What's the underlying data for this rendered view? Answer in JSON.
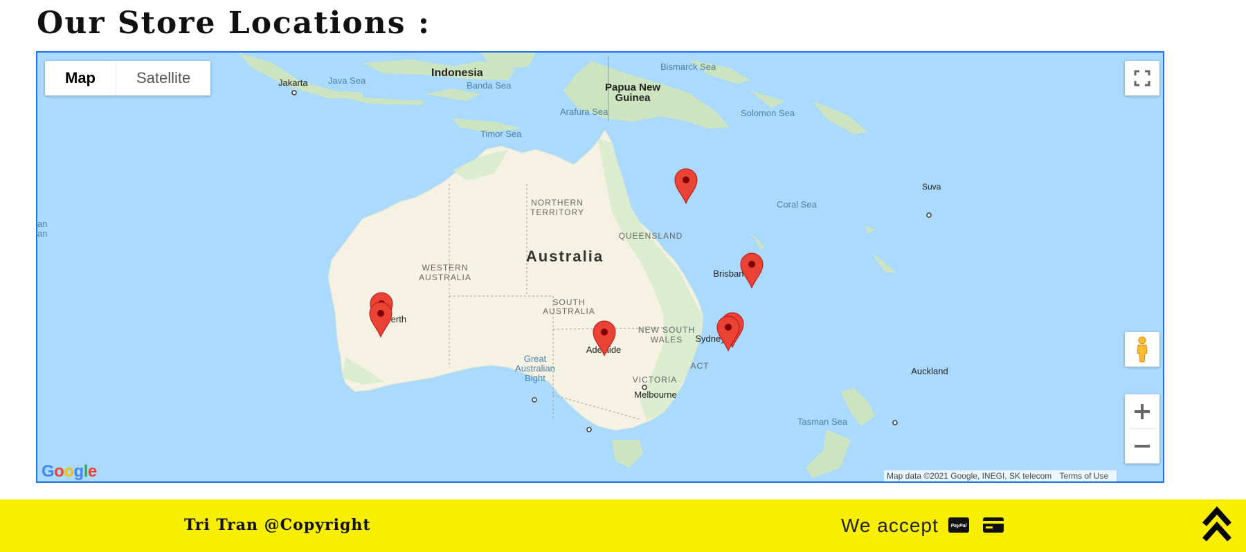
{
  "page": {
    "title": "Our Store Locations :"
  },
  "map": {
    "type_controls": {
      "map_label": "Map",
      "satellite_label": "Satellite",
      "selected": "Map"
    },
    "logo": "Google",
    "attribution": {
      "data": "Map data ©2021 Google, INEGI, SK telecom",
      "terms": "Terms of Use"
    },
    "labels": {
      "indonesia": "Indonesia",
      "jakarta": "Jakarta",
      "java_sea": "Java Sea",
      "banda_sea": "Banda Sea",
      "bismarck_sea": "Bismarck Sea",
      "png_1": "Papua New",
      "png_2": "Guinea",
      "solomon_sea": "Solomon Sea",
      "arafura_sea": "Arafura Sea",
      "timor_sea": "Timor Sea",
      "northern_territory_1": "NORTHERN",
      "northern_territory_2": "TERRITORY",
      "queensland": "QUEENSLAND",
      "coral_sea": "Coral Sea",
      "suva": "Suva",
      "australia": "Australia",
      "western_australia_1": "WESTERN",
      "western_australia_2": "AUSTRALIA",
      "south_australia_1": "SOUTH",
      "south_australia_2": "AUSTRALIA",
      "brisbane": "Brisbane",
      "perth": "Perth",
      "new_south_wales_1": "NEW SOUTH",
      "new_south_wales_2": "WALES",
      "sydney": "Sydney",
      "adelaide": "Adelaide",
      "act": "ACT",
      "great_australian_bight_1": "Great",
      "great_australian_bight_2": "Australian",
      "great_australian_bight_3": "Bight",
      "victoria": "VICTORIA",
      "melbourne": "Melbourne",
      "auckland": "Auckland",
      "tasman_sea": "Tasman Sea",
      "edge_text_1": "an",
      "edge_text_2": "an"
    },
    "markers_count_visible": 7,
    "colors": {
      "water": "#aadaff",
      "land": "#f5f1e3",
      "land_green": "#cfe6c2",
      "marker": "#ea4335"
    }
  },
  "footer": {
    "copyright": "Tri Tran @Copyright",
    "accept_label": "We accept",
    "paypal_text": "PayPal",
    "icons": [
      "paypal-icon",
      "credit-card-icon",
      "scroll-to-top-icon"
    ],
    "background": "#f8ef00"
  }
}
